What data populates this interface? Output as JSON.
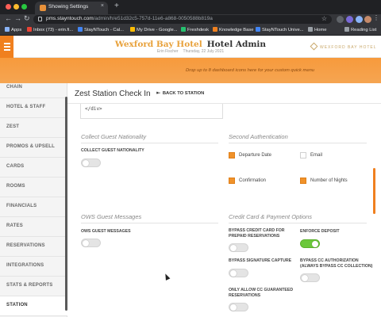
{
  "browser": {
    "tab_title": "Showing Settings",
    "tab_close": "×",
    "new_tab": "+",
    "back": "←",
    "forward": "→",
    "reload": "↻",
    "url_host": "pms.stayntouch.com",
    "url_path": "/admin/h/e51d32c5-757d-11e6-a868-0050588b819a",
    "star": "☆",
    "menu": "⋮",
    "bookmarks": [
      "Apps",
      "Inbox (73) - erin.fi...",
      "StayNTouch - Cal...",
      "My Drive - Google...",
      "Freshdesk",
      "Knowledge Base",
      "StayNTouch Unive...",
      "Home"
    ],
    "reading_list": "Reading List"
  },
  "header": {
    "hotel_name": "Wexford Bay Hotel",
    "admin_title": "Hotel Admin",
    "user_name": "Erin Fischer",
    "date": "Thursday, 22 July 2021",
    "brand": "WEXFORD BAY HOTEL"
  },
  "banner": {
    "text": "Drop up to 8 dashboard icons here for your custom quick menu"
  },
  "sidebar": {
    "items": [
      {
        "label": "CHAIN"
      },
      {
        "label": "HOTEL & STAFF"
      },
      {
        "label": "ZEST"
      },
      {
        "label": "PROMOS & UPSELL"
      },
      {
        "label": "CARDS"
      },
      {
        "label": "ROOMS"
      },
      {
        "label": "FINANCIALS"
      },
      {
        "label": "RATES"
      },
      {
        "label": "RESERVATIONS"
      },
      {
        "label": "INTEGRATIONS"
      },
      {
        "label": "STATS & REPORTS"
      },
      {
        "label": "STATION"
      }
    ]
  },
  "main": {
    "title": "Zest Station Check In",
    "back_label": "BACK TO STATION",
    "back_arrow": "⇤",
    "code_snippet": "</div>",
    "nationality": {
      "title": "Collect Guest Nationality",
      "field_label": "COLLECT GUEST NATIONALITY",
      "enabled": false
    },
    "second_auth": {
      "title": "Second Authentication",
      "options": [
        {
          "label": "Departure Date",
          "checked": true
        },
        {
          "label": "Email",
          "checked": false
        },
        {
          "label": "Confirmation",
          "checked": true
        },
        {
          "label": "Number of Nights",
          "checked": true
        }
      ]
    },
    "ows": {
      "title": "OWS Guest Messages",
      "field_label": "OWS GUEST MESSAGES",
      "enabled": false
    },
    "cc_payment": {
      "title": "Credit Card & Payment Options",
      "fields": {
        "bypass_cc_prepaid": {
          "label": "BYPASS CREDIT CARD FOR PREPAID RESERVATIONS",
          "enabled": false
        },
        "enforce_deposit": {
          "label": "ENFORCE DEPOSIT",
          "enabled": true
        },
        "bypass_signature": {
          "label": "BYPASS SIGNATURE CAPTURE",
          "enabled": false
        },
        "bypass_cc_auth": {
          "label": "BYPASS CC AUTHORIZATION (ALWAYS BYPASS CC COLLECTION)",
          "enabled": false
        },
        "only_cc_guaranteed": {
          "label": "ONLY ALLOW CC GUARANTEED RESERVATIONS",
          "enabled": false
        }
      }
    }
  },
  "colors": {
    "accent": "#f0801f",
    "hotel_name": "#e8a13a",
    "toggle_on": "#6bc83a",
    "checkbox_on": "#f0922a"
  }
}
